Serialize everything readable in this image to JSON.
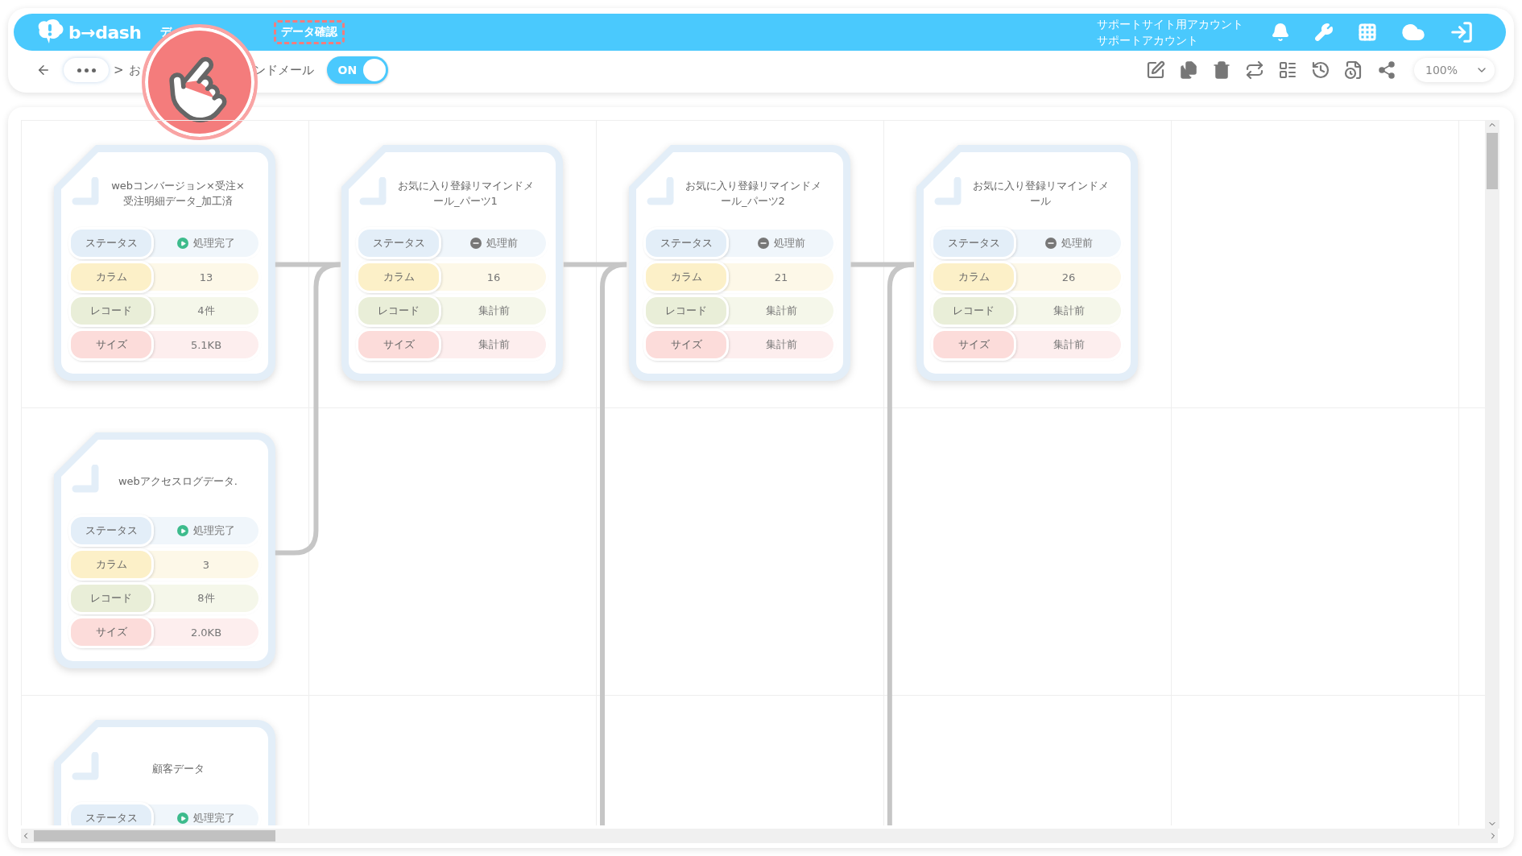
{
  "header": {
    "logo": "b→dash",
    "nav_items": [
      {
        "label": "デ",
        "highlighted": false
      },
      {
        "label": "データ確認",
        "highlighted": true
      }
    ],
    "account": [
      "サポートサイト用アカウント",
      "サポートアカウント"
    ]
  },
  "breadcrumb": {
    "separator": ">",
    "crumbs": [
      "お",
      "ンドメール"
    ],
    "toggle": {
      "label": "ON",
      "on": true
    }
  },
  "zoom": {
    "value": "100%"
  },
  "columns": [
    {
      "cards": [
        {
          "title": "webコンバージョン×受注×受注明細データ_加工済",
          "rows": [
            {
              "kind": "status",
              "label": "ステータス",
              "value": "処理完了",
              "complete": true
            },
            {
              "kind": "columns",
              "label": "カラム",
              "value": "13"
            },
            {
              "kind": "records",
              "label": "レコード",
              "value": "4件"
            },
            {
              "kind": "size",
              "label": "サイズ",
              "value": "5.1KB"
            }
          ]
        },
        {
          "title": "webアクセスログデータ.",
          "rows": [
            {
              "kind": "status",
              "label": "ステータス",
              "value": "処理完了",
              "complete": true
            },
            {
              "kind": "columns",
              "label": "カラム",
              "value": "3"
            },
            {
              "kind": "records",
              "label": "レコード",
              "value": "8件"
            },
            {
              "kind": "size",
              "label": "サイズ",
              "value": "2.0KB"
            }
          ]
        },
        {
          "title": "顧客データ",
          "rows": [
            {
              "kind": "status",
              "label": "ステータス",
              "value": "処理完了",
              "complete": true
            }
          ]
        }
      ]
    },
    {
      "cards": [
        {
          "title": "お気に入り登録リマインドメール_パーツ1",
          "rows": [
            {
              "kind": "status",
              "label": "ステータス",
              "value": "処理前",
              "complete": false
            },
            {
              "kind": "columns",
              "label": "カラム",
              "value": "16"
            },
            {
              "kind": "records",
              "label": "レコード",
              "value": "集計前"
            },
            {
              "kind": "size",
              "label": "サイズ",
              "value": "集計前"
            }
          ]
        }
      ]
    },
    {
      "cards": [
        {
          "title": "お気に入り登録リマインドメール_パーツ2",
          "rows": [
            {
              "kind": "status",
              "label": "ステータス",
              "value": "処理前",
              "complete": false
            },
            {
              "kind": "columns",
              "label": "カラム",
              "value": "21"
            },
            {
              "kind": "records",
              "label": "レコード",
              "value": "集計前"
            },
            {
              "kind": "size",
              "label": "サイズ",
              "value": "集計前"
            }
          ]
        }
      ]
    },
    {
      "cards": [
        {
          "title": "お気に入り登録リマインドメール",
          "rows": [
            {
              "kind": "status",
              "label": "ステータス",
              "value": "処理前",
              "complete": false
            },
            {
              "kind": "columns",
              "label": "カラム",
              "value": "26"
            },
            {
              "kind": "records",
              "label": "レコード",
              "value": "集計前"
            },
            {
              "kind": "size",
              "label": "サイズ",
              "value": "集計前"
            }
          ]
        }
      ]
    },
    {},
    {}
  ]
}
